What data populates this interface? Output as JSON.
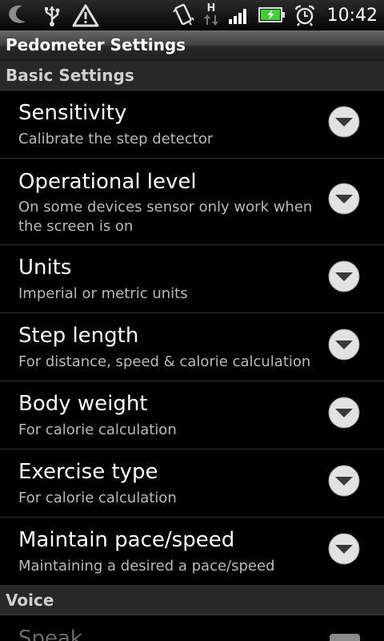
{
  "status_bar": {
    "time": "10:42",
    "network_label": "H",
    "icons": [
      "app-icon",
      "usb-icon",
      "warning-icon",
      "vibrate-icon",
      "data-transfer-icon",
      "signal-icon",
      "battery-charging-icon",
      "alarm-icon"
    ],
    "colors": {
      "battery": "#37d52b"
    }
  },
  "title_bar": {
    "title": "Pedometer Settings"
  },
  "categories": [
    {
      "label": "Basic Settings"
    },
    {
      "label": "Voice"
    }
  ],
  "preferences": [
    {
      "title": "Sensitivity",
      "summary": "Calibrate the step detector",
      "icon": "dropdown-arrow-icon"
    },
    {
      "title": "Operational level",
      "summary": "On some devices sensor only work when the screen is on",
      "icon": "dropdown-arrow-icon"
    },
    {
      "title": "Units",
      "summary": "Imperial or metric units",
      "icon": "dropdown-arrow-icon"
    },
    {
      "title": "Step length",
      "summary": "For distance, speed & calorie calculation",
      "icon": "dropdown-arrow-icon"
    },
    {
      "title": "Body weight",
      "summary": "For calorie calculation",
      "icon": "dropdown-arrow-icon"
    },
    {
      "title": "Exercise type",
      "summary": "For calorie calculation",
      "icon": "dropdown-arrow-icon"
    },
    {
      "title": "Maintain pace/speed",
      "summary": "Maintaining a desired a pace/speed",
      "icon": "dropdown-arrow-icon"
    }
  ],
  "voice_preferences": [
    {
      "title": "Speak",
      "state": "disabled"
    }
  ]
}
